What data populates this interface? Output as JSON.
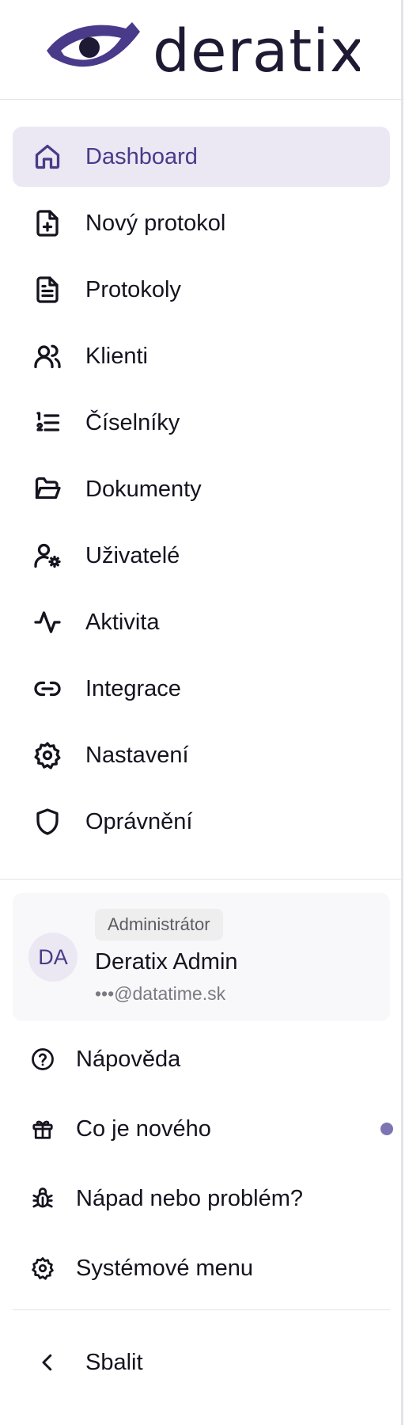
{
  "brand": {
    "name": "deratix",
    "color": "#4a3a8a",
    "dark_color": "#1f1a33"
  },
  "nav": {
    "items": [
      {
        "label": "Dashboard",
        "icon": "home-icon",
        "active": true
      },
      {
        "label": "Nový protokol",
        "icon": "file-plus-icon"
      },
      {
        "label": "Protokoly",
        "icon": "file-text-icon"
      },
      {
        "label": "Klienti",
        "icon": "users-icon"
      },
      {
        "label": "Číselníky",
        "icon": "list-ordered-icon"
      },
      {
        "label": "Dokumenty",
        "icon": "folder-open-icon"
      },
      {
        "label": "Uživatelé",
        "icon": "user-cog-icon"
      },
      {
        "label": "Aktivita",
        "icon": "activity-icon"
      },
      {
        "label": "Integrace",
        "icon": "link-icon"
      },
      {
        "label": "Nastavení",
        "icon": "settings-icon"
      },
      {
        "label": "Oprávnění",
        "icon": "shield-icon"
      }
    ]
  },
  "user": {
    "initials": "DA",
    "role": "Administrátor",
    "name": "Deratix Admin",
    "email": "•••@datatime.sk"
  },
  "bottom": {
    "items": [
      {
        "label": "Nápověda",
        "icon": "help-circle-icon"
      },
      {
        "label": "Co je nového",
        "icon": "gift-icon",
        "has_notification": true
      },
      {
        "label": "Nápad nebo problém?",
        "icon": "bug-icon"
      },
      {
        "label": "Systémové menu",
        "icon": "settings-icon"
      }
    ],
    "collapse_label": "Sbalit",
    "collapse_icon": "chevron-left-icon"
  },
  "colors": {
    "active_bg": "#ebe8f3",
    "accent": "#4a3a8a",
    "notification_dot": "#7d74b3"
  }
}
